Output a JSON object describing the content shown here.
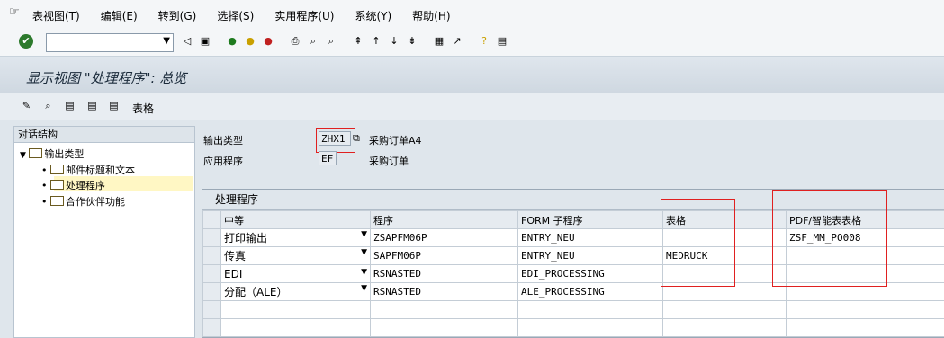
{
  "menu": {
    "items": [
      "表视图(T)",
      "编辑(E)",
      "转到(G)",
      "选择(S)",
      "实用程序(U)",
      "系统(Y)",
      "帮助(H)"
    ]
  },
  "title": "显示视图 \"处理程序\": 总览",
  "app_toolbar": {
    "table_label": "表格"
  },
  "nav": {
    "header": "对话结构",
    "root": "输出类型",
    "children": [
      "邮件标题和文本",
      "处理程序",
      "合作伙伴功能"
    ]
  },
  "fields": {
    "output_type_label": "输出类型",
    "output_type_value": "ZHX1",
    "output_type_desc": "采购订单A4",
    "application_label": "应用程序",
    "application_value": "EF",
    "application_desc": "采购订单"
  },
  "grid": {
    "title": "处理程序",
    "columns": [
      "中等",
      "程序",
      "FORM 子程序",
      "表格",
      "PDF/智能表表格"
    ],
    "rows": [
      [
        "打印输出",
        "ZSAPFM06P",
        "ENTRY_NEU",
        "",
        "ZSF_MM_PO008"
      ],
      [
        "传真",
        "SAPFM06P",
        "ENTRY_NEU",
        "MEDRUCK",
        ""
      ],
      [
        "EDI",
        "RSNASTED",
        "EDI_PROCESSING",
        "",
        ""
      ],
      [
        "分配（ALE）",
        "RSNASTED",
        "ALE_PROCESSING",
        "",
        ""
      ]
    ]
  }
}
